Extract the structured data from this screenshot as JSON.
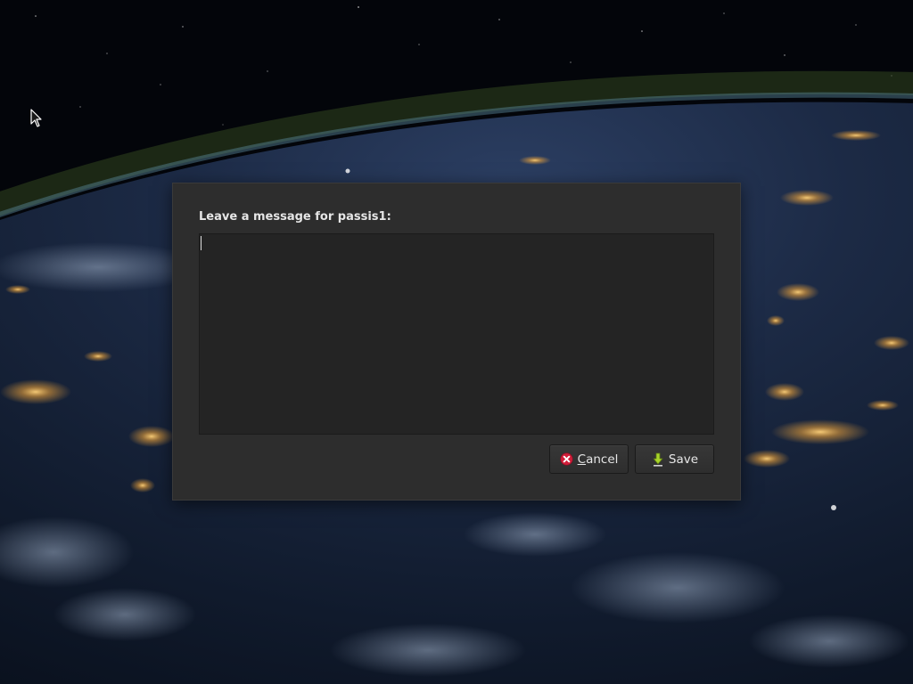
{
  "dialog": {
    "prompt": "Leave a message for passis1:",
    "message": {
      "value": "",
      "placeholder": ""
    },
    "buttons": {
      "cancel": {
        "mnemonic": "C",
        "label_rest": "ancel",
        "icon": "cancel-icon",
        "icon_color": "#d11e3a"
      },
      "save": {
        "label": "Save",
        "icon": "save-icon",
        "icon_color": "#a8d42b"
      }
    }
  },
  "desktop": {
    "wallpaper": "earth-at-night",
    "cursor": "arrow-pointer"
  }
}
